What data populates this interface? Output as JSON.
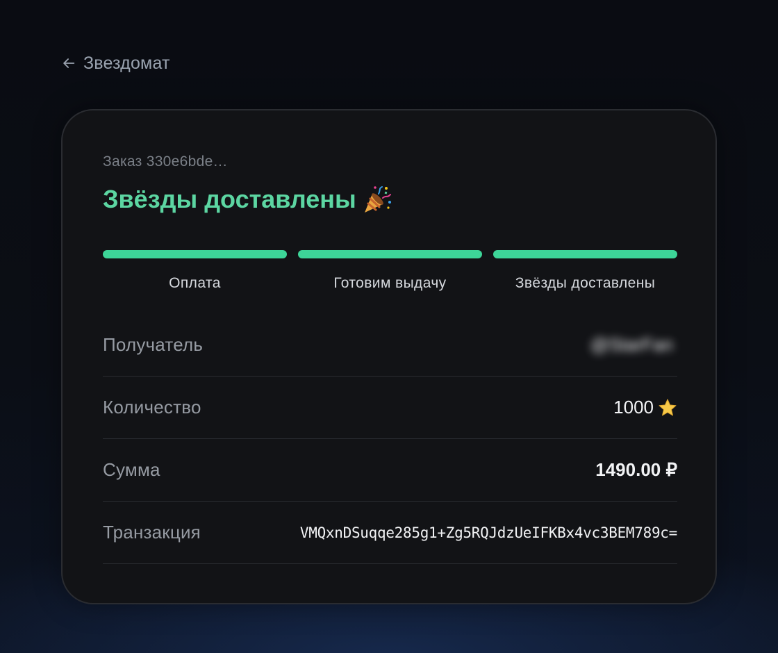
{
  "header": {
    "back_label": "Звездомат"
  },
  "order": {
    "id_label": "Заказ 330e6bde…",
    "status_title": "Звёзды доставлены",
    "status_icon": "party-popper-icon"
  },
  "steps": [
    {
      "label": "Оплата",
      "completed": true
    },
    {
      "label": "Готовим выдачу",
      "completed": true
    },
    {
      "label": "Звёзды доставлены",
      "completed": true
    }
  ],
  "details": {
    "recipient": {
      "key": "Получатель",
      "value": "@StarFan"
    },
    "quantity": {
      "key": "Количество",
      "value": "1000",
      "icon": "star-icon"
    },
    "amount": {
      "key": "Сумма",
      "value": "1490.00 ₽"
    },
    "transaction": {
      "key": "Транзакция",
      "value": "VMQxnDSuqqe285g1+Zg5RQJdzUeIFKBx4vc3BEM789c="
    }
  },
  "colors": {
    "accent": "#3dd598",
    "title": "#5cd6a2",
    "card_bg": "#121316",
    "page_bg": "#0a0c12"
  }
}
